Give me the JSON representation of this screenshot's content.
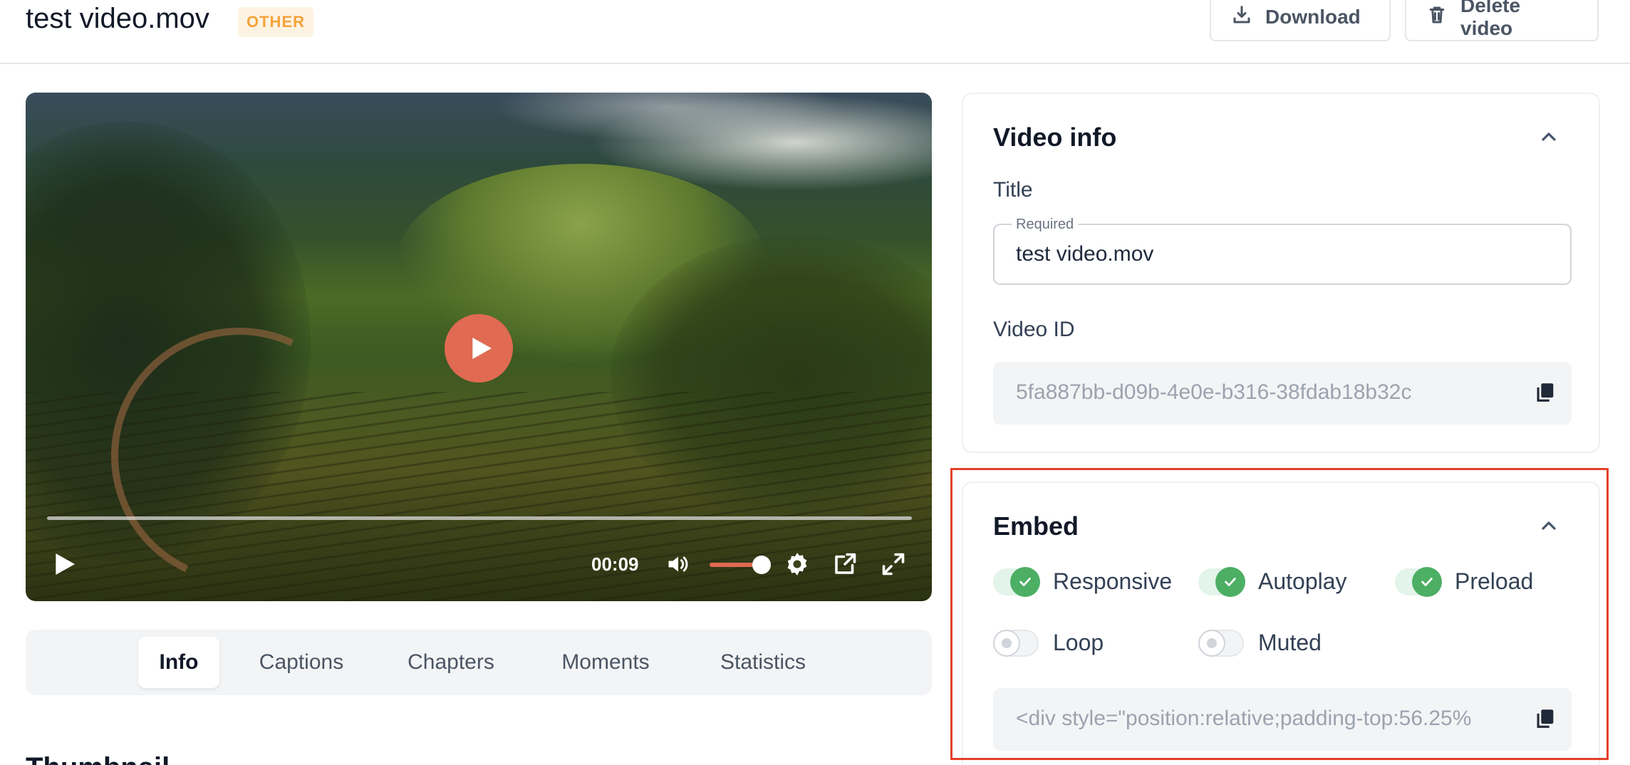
{
  "header": {
    "title": "test video.mov",
    "badge": "OTHER",
    "download_label": "Download",
    "delete_label": "Delete video"
  },
  "player": {
    "time": "00:09",
    "accent_color": "#e06a52"
  },
  "tabs": [
    {
      "label": "Info",
      "active": true
    },
    {
      "label": "Captions",
      "active": false
    },
    {
      "label": "Chapters",
      "active": false
    },
    {
      "label": "Moments",
      "active": false
    },
    {
      "label": "Statistics",
      "active": false
    }
  ],
  "section_below": "Thumbnail",
  "video_info": {
    "title": "Video info",
    "title_label": "Title",
    "title_legend": "Required",
    "title_value": "test video.mov",
    "id_label": "Video ID",
    "id_value": "5fa887bb-d09b-4e0e-b316-38fdab18b32c"
  },
  "embed": {
    "title": "Embed",
    "options": [
      {
        "label": "Responsive",
        "checked": true
      },
      {
        "label": "Autoplay",
        "checked": true
      },
      {
        "label": "Preload",
        "checked": true
      },
      {
        "label": "Loop",
        "checked": false
      },
      {
        "label": "Muted",
        "checked": false
      }
    ],
    "code": "<div style=\"position:relative;padding-top:56.25%"
  },
  "colors": {
    "badge_text": "#f5a23a",
    "toggle_on": "#4caf64",
    "highlight": "#e2412b"
  }
}
